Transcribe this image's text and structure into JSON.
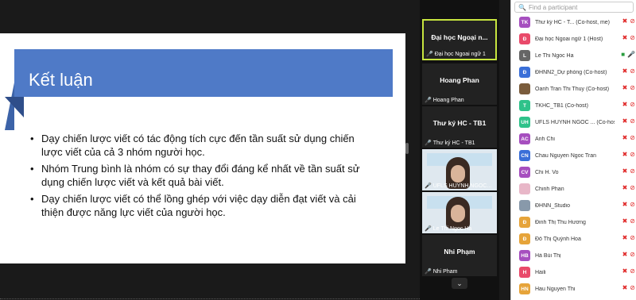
{
  "slide": {
    "title": "Kết luận",
    "bullets": [
      "Dạy chiến lược viết có tác động tích cực đến tần suất sử dụng chiến lược viết của cả 3 nhóm người học.",
      "Nhóm Trung bình là nhóm có sự thay đổi đáng kể nhất về tần suất sử dụng chiến lược viết và kết quả bài viết.",
      "Dạy chiến lược viết có thể lồng ghép với việc dạy diễn đạt viết và cải thiện được năng lực viết của người học."
    ]
  },
  "strip": {
    "tiles": [
      {
        "name": "Đại học Ngoại n...",
        "label": "Đại học Ngoai ngữ 1"
      },
      {
        "name": "Hoang Phan",
        "label": "Hoang Phan"
      },
      {
        "name": "Thư ký HC - TB1",
        "label": "Thư ký HC - TB1"
      },
      {
        "name": "",
        "label": "UFLS HUYNH NGOC..."
      },
      {
        "name": "",
        "label": "Le Thi Ngoc Ha"
      },
      {
        "name": "Nhi Phạm",
        "label": "Nhi Pham"
      }
    ]
  },
  "panel": {
    "search_placeholder": "Find a participant",
    "participants": [
      {
        "initials": "TK",
        "color": "#a64fbf",
        "name": "Thư ký HC - T... (Co-host, me)"
      },
      {
        "initials": "Đ",
        "color": "#e94a6a",
        "name": "Đại học Ngoai ngữ 1 (Host)"
      },
      {
        "initials": "L",
        "color": "#666666",
        "name": "Le Thi Ngoc Ha"
      },
      {
        "initials": "Đ",
        "color": "#3a6fd8",
        "name": "ĐHNN2_Dự phòng (Co-host)"
      },
      {
        "initials": "",
        "color": "#7a5c3c",
        "name": "Oanh Tran Thi Thuy (Co-host)"
      },
      {
        "initials": "T",
        "color": "#2fc28a",
        "name": "TKHC_TB1 (Co-host)"
      },
      {
        "initials": "UH",
        "color": "#2fc28a",
        "name": "UFLS HUYNH NGOC ... (Co-host)"
      },
      {
        "initials": "AC",
        "color": "#a64fbf",
        "name": "Anh Chi"
      },
      {
        "initials": "CN",
        "color": "#3a6fd8",
        "name": "Chau Nguyen Ngoc Tran"
      },
      {
        "initials": "CV",
        "color": "#a64fbf",
        "name": "Chi H. Vo"
      },
      {
        "initials": "",
        "color": "#e8b7c8",
        "name": "Chinh Phan"
      },
      {
        "initials": "",
        "color": "#8899aa",
        "name": "ĐHNN_Studio"
      },
      {
        "initials": "Đ",
        "color": "#e6a43a",
        "name": "Đinh Thị Thu Hương"
      },
      {
        "initials": "Đ",
        "color": "#e6a43a",
        "name": "Đỗ Thị Quỳnh Hoa"
      },
      {
        "initials": "HB",
        "color": "#a64fbf",
        "name": "Hà Bùi Thị"
      },
      {
        "initials": "H",
        "color": "#e94a6a",
        "name": "Haili"
      },
      {
        "initials": "HN",
        "color": "#e6a43a",
        "name": "Hau Nguyen Thi"
      }
    ]
  }
}
